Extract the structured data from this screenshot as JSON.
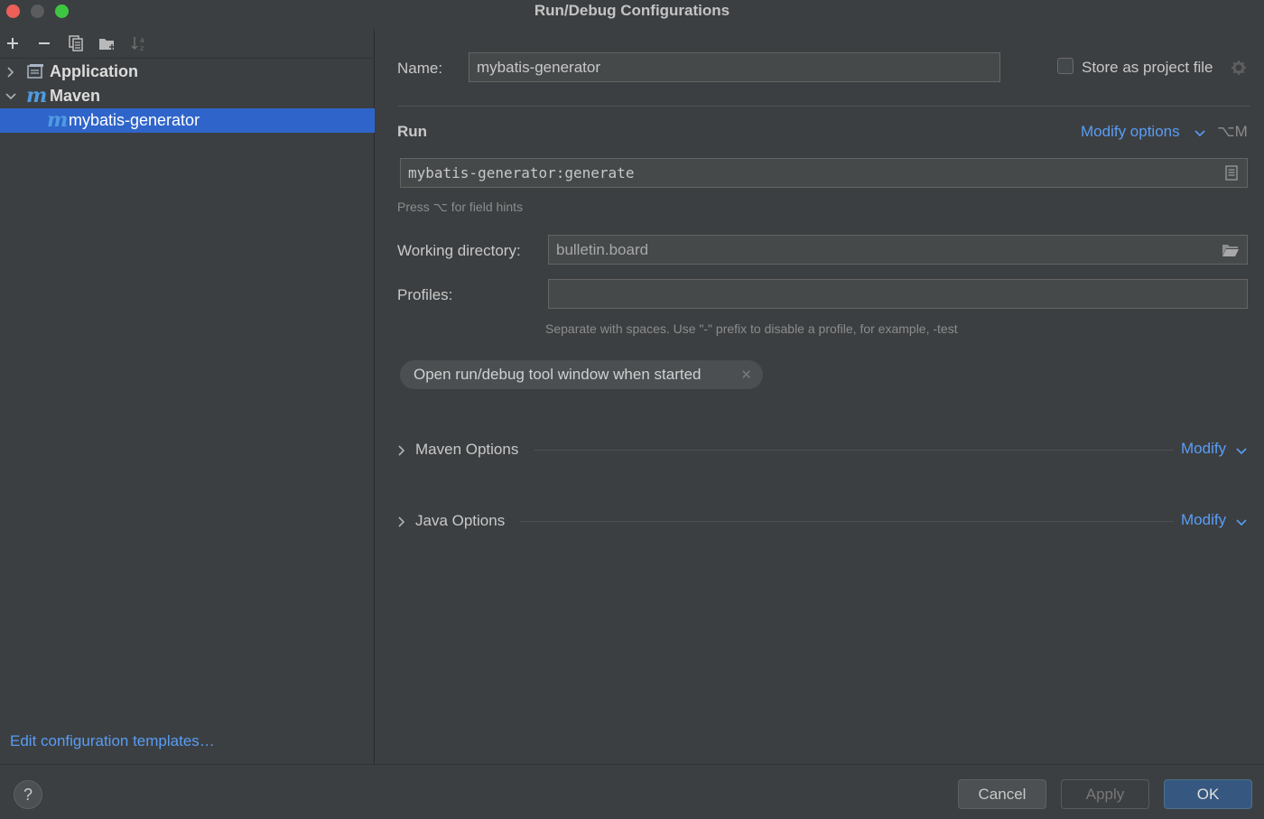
{
  "window": {
    "title": "Run/Debug Configurations"
  },
  "toolbar": {
    "icons": [
      "add-icon",
      "remove-icon",
      "copy-icon",
      "folder-add-icon",
      "sort-icon"
    ]
  },
  "tree": {
    "items": [
      {
        "label": "Application",
        "icon": "application-icon",
        "expanded": false
      },
      {
        "label": "Maven",
        "icon": "maven-icon",
        "expanded": true
      },
      {
        "label": "mybatis-generator",
        "icon": "maven-icon",
        "selected": true
      }
    ],
    "maven_glyph": "m"
  },
  "left_footer": {
    "edit_templates": "Edit configuration templates…"
  },
  "form": {
    "name_label": "Name:",
    "name_value": "mybatis-generator",
    "store_label": "Store as project file",
    "run_title": "Run",
    "modify_options": "Modify options",
    "modify_shortcut": "⌥M",
    "command_value": "mybatis-generator:generate",
    "field_hint": "Press ⌥ for field hints",
    "working_dir_label": "Working directory:",
    "working_dir_value": "bulletin.board",
    "profiles_label": "Profiles:",
    "profiles_value": "",
    "profiles_hint": "Separate with spaces. Use \"-\" prefix to disable a profile, for example, -test",
    "tag_label": "Open run/debug tool window when started",
    "sections": [
      {
        "title": "Maven Options",
        "modify": "Modify"
      },
      {
        "title": "Java Options",
        "modify": "Modify"
      }
    ]
  },
  "buttons": {
    "help": "?",
    "cancel": "Cancel",
    "apply": "Apply",
    "ok": "OK"
  },
  "colors": {
    "background": "#3c3f41",
    "selection": "#2f65ca",
    "link": "#589df6",
    "primary_button": "#365880"
  }
}
